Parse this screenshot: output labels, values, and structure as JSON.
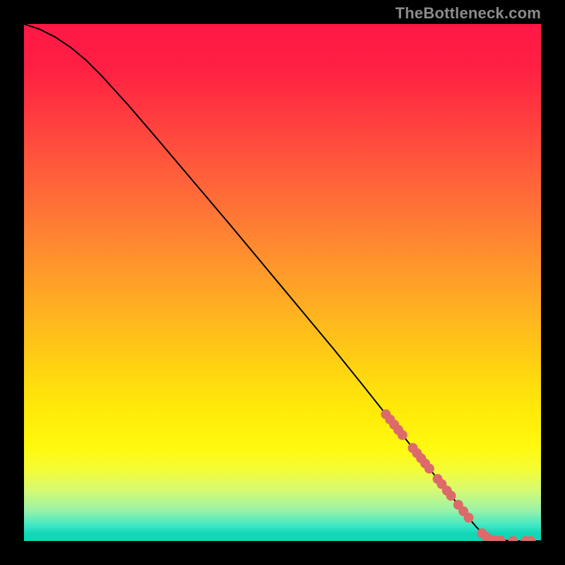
{
  "watermark": "TheBottleneck.com",
  "chart_data": {
    "type": "line",
    "title": "",
    "xlabel": "",
    "ylabel": "",
    "xlim": [
      0,
      100
    ],
    "ylim": [
      0,
      100
    ],
    "grid": false,
    "curve": {
      "name": "bottleneck-curve",
      "color": "#000000",
      "x": [
        0,
        3,
        6,
        9,
        12,
        15,
        20,
        25,
        30,
        35,
        40,
        45,
        50,
        55,
        60,
        65,
        70,
        72,
        74,
        76,
        78,
        80,
        82,
        84,
        86,
        87.5,
        89,
        91,
        93,
        95,
        97,
        100
      ],
      "y": [
        100,
        99,
        97.5,
        95.5,
        93,
        90,
        84.5,
        78.7,
        72.8,
        66.9,
        61,
        55,
        49,
        43,
        37,
        30.8,
        24.5,
        22,
        19.5,
        17,
        14.5,
        12,
        9.5,
        7,
        4.5,
        2.7,
        1.2,
        0.4,
        0.1,
        0,
        0,
        0
      ]
    },
    "markers": {
      "name": "highlighted-points",
      "color": "#dd6a6a",
      "radius_px": 7,
      "points": [
        {
          "x": 70.0,
          "y": 24.5
        },
        {
          "x": 70.8,
          "y": 23.5
        },
        {
          "x": 71.6,
          "y": 22.5
        },
        {
          "x": 72.4,
          "y": 21.5
        },
        {
          "x": 73.2,
          "y": 20.5
        },
        {
          "x": 75.2,
          "y": 18.0
        },
        {
          "x": 76.0,
          "y": 17.0
        },
        {
          "x": 76.8,
          "y": 16.0
        },
        {
          "x": 77.6,
          "y": 15.0
        },
        {
          "x": 78.4,
          "y": 14.0
        },
        {
          "x": 80.0,
          "y": 12.0
        },
        {
          "x": 80.8,
          "y": 11.0
        },
        {
          "x": 81.8,
          "y": 9.75
        },
        {
          "x": 82.6,
          "y": 8.75
        },
        {
          "x": 84.0,
          "y": 7.0
        },
        {
          "x": 85.0,
          "y": 5.75
        },
        {
          "x": 86.0,
          "y": 4.5
        },
        {
          "x": 88.6,
          "y": 1.5
        },
        {
          "x": 89.4,
          "y": 0.8
        },
        {
          "x": 90.2,
          "y": 0.3
        },
        {
          "x": 91.2,
          "y": 0.12
        },
        {
          "x": 92.2,
          "y": 0.05
        },
        {
          "x": 94.6,
          "y": 0.0
        },
        {
          "x": 97.0,
          "y": 0.0
        },
        {
          "x": 98.0,
          "y": 0.0
        }
      ]
    }
  }
}
